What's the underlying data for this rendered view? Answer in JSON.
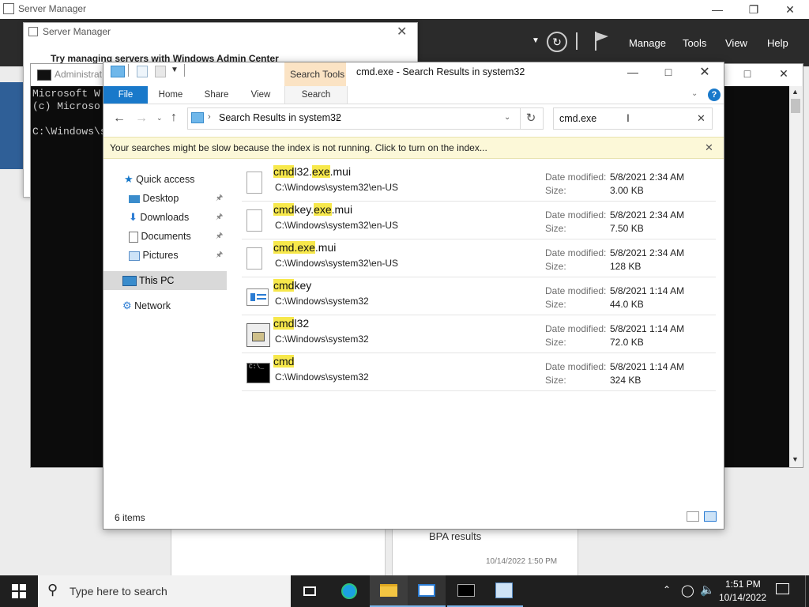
{
  "server_manager": {
    "title": "Server Manager",
    "menu": [
      "Manage",
      "Tools",
      "View",
      "Help"
    ],
    "bpa_label": "BPA results",
    "ghost_timestamp": "10/14/2022 1:50 PM"
  },
  "sm_dialog": {
    "title": "Server Manager",
    "heading": "Try managing servers with Windows Admin Center"
  },
  "cmd": {
    "title": "Administrat",
    "lines": [
      "Microsoft W",
      "(c) Microso",
      "",
      "C:\\Windows\\s"
    ]
  },
  "explorer": {
    "title": "cmd.exe - Search Results in system32",
    "contextual_tab_group": "Search Tools",
    "tabs": [
      "File",
      "Home",
      "Share",
      "View",
      "Search"
    ],
    "breadcrumb": "Search Results in system32",
    "search_value": "cmd.exe",
    "info_message": "Your searches might be slow because the index is not running.  Click to turn on the index...",
    "nav": {
      "quick_access": "Quick access",
      "desktop": "Desktop",
      "downloads": "Downloads",
      "documents": "Documents",
      "pictures": "Pictures",
      "this_pc": "This PC",
      "network": "Network"
    },
    "labels": {
      "date_modified": "Date modified:",
      "size": "Size:"
    },
    "files": [
      {
        "name_parts": [
          {
            "t": "cmd",
            "hl": true
          },
          {
            "t": "l32",
            "hl": false
          },
          {
            "t": "exe",
            "hl": true
          },
          {
            "t": ".mui",
            "hl": false
          }
        ],
        "name_dot": ".",
        "path": "C:\\Windows\\system32\\en-US",
        "date": "5/8/2021 2:34 AM",
        "size": "3.00 KB",
        "icon": "generic-file-icon"
      },
      {
        "name_parts": [
          {
            "t": "cmd",
            "hl": true
          },
          {
            "t": "key",
            "hl": false
          },
          {
            "t": "exe",
            "hl": true
          },
          {
            "t": ".mui",
            "hl": false
          }
        ],
        "name_dot": ".",
        "path": "C:\\Windows\\system32\\en-US",
        "date": "5/8/2021 2:34 AM",
        "size": "7.50 KB",
        "icon": "generic-file-icon"
      },
      {
        "name_parts": [
          {
            "t": "cmd.exe",
            "hl": true
          },
          {
            "t": ".mui",
            "hl": false
          }
        ],
        "path": "C:\\Windows\\system32\\en-US",
        "date": "5/8/2021 2:34 AM",
        "size": "128 KB",
        "icon": "generic-file-icon"
      },
      {
        "name_parts": [
          {
            "t": "cmd",
            "hl": true
          },
          {
            "t": "key",
            "hl": false
          }
        ],
        "path": "C:\\Windows\\system32",
        "date": "5/8/2021 1:14 AM",
        "size": "44.0 KB",
        "icon": "cmdkey-app-icon"
      },
      {
        "name_parts": [
          {
            "t": "cmd",
            "hl": true
          },
          {
            "t": "l32",
            "hl": false
          }
        ],
        "path": "C:\\Windows\\system32",
        "date": "5/8/2021 1:14 AM",
        "size": "72.0 KB",
        "icon": "control-panel-app-icon"
      },
      {
        "name_parts": [
          {
            "t": "cmd",
            "hl": true
          }
        ],
        "path": "C:\\Windows\\system32",
        "date": "5/8/2021 1:14 AM",
        "size": "324 KB",
        "icon": "command-prompt-icon"
      }
    ],
    "status": "6 items"
  },
  "taskbar": {
    "search_placeholder": "Type here to search",
    "time": "1:51 PM",
    "date": "10/14/2022"
  },
  "colors": {
    "highlight": "#f7e84b",
    "file_tab": "#1979ca",
    "search_tools_tab": "#fbe3c4",
    "info_bar": "#fcf8d8",
    "server_manager_header": "#2b2b2b",
    "taskbar": "#1f1f1f"
  }
}
